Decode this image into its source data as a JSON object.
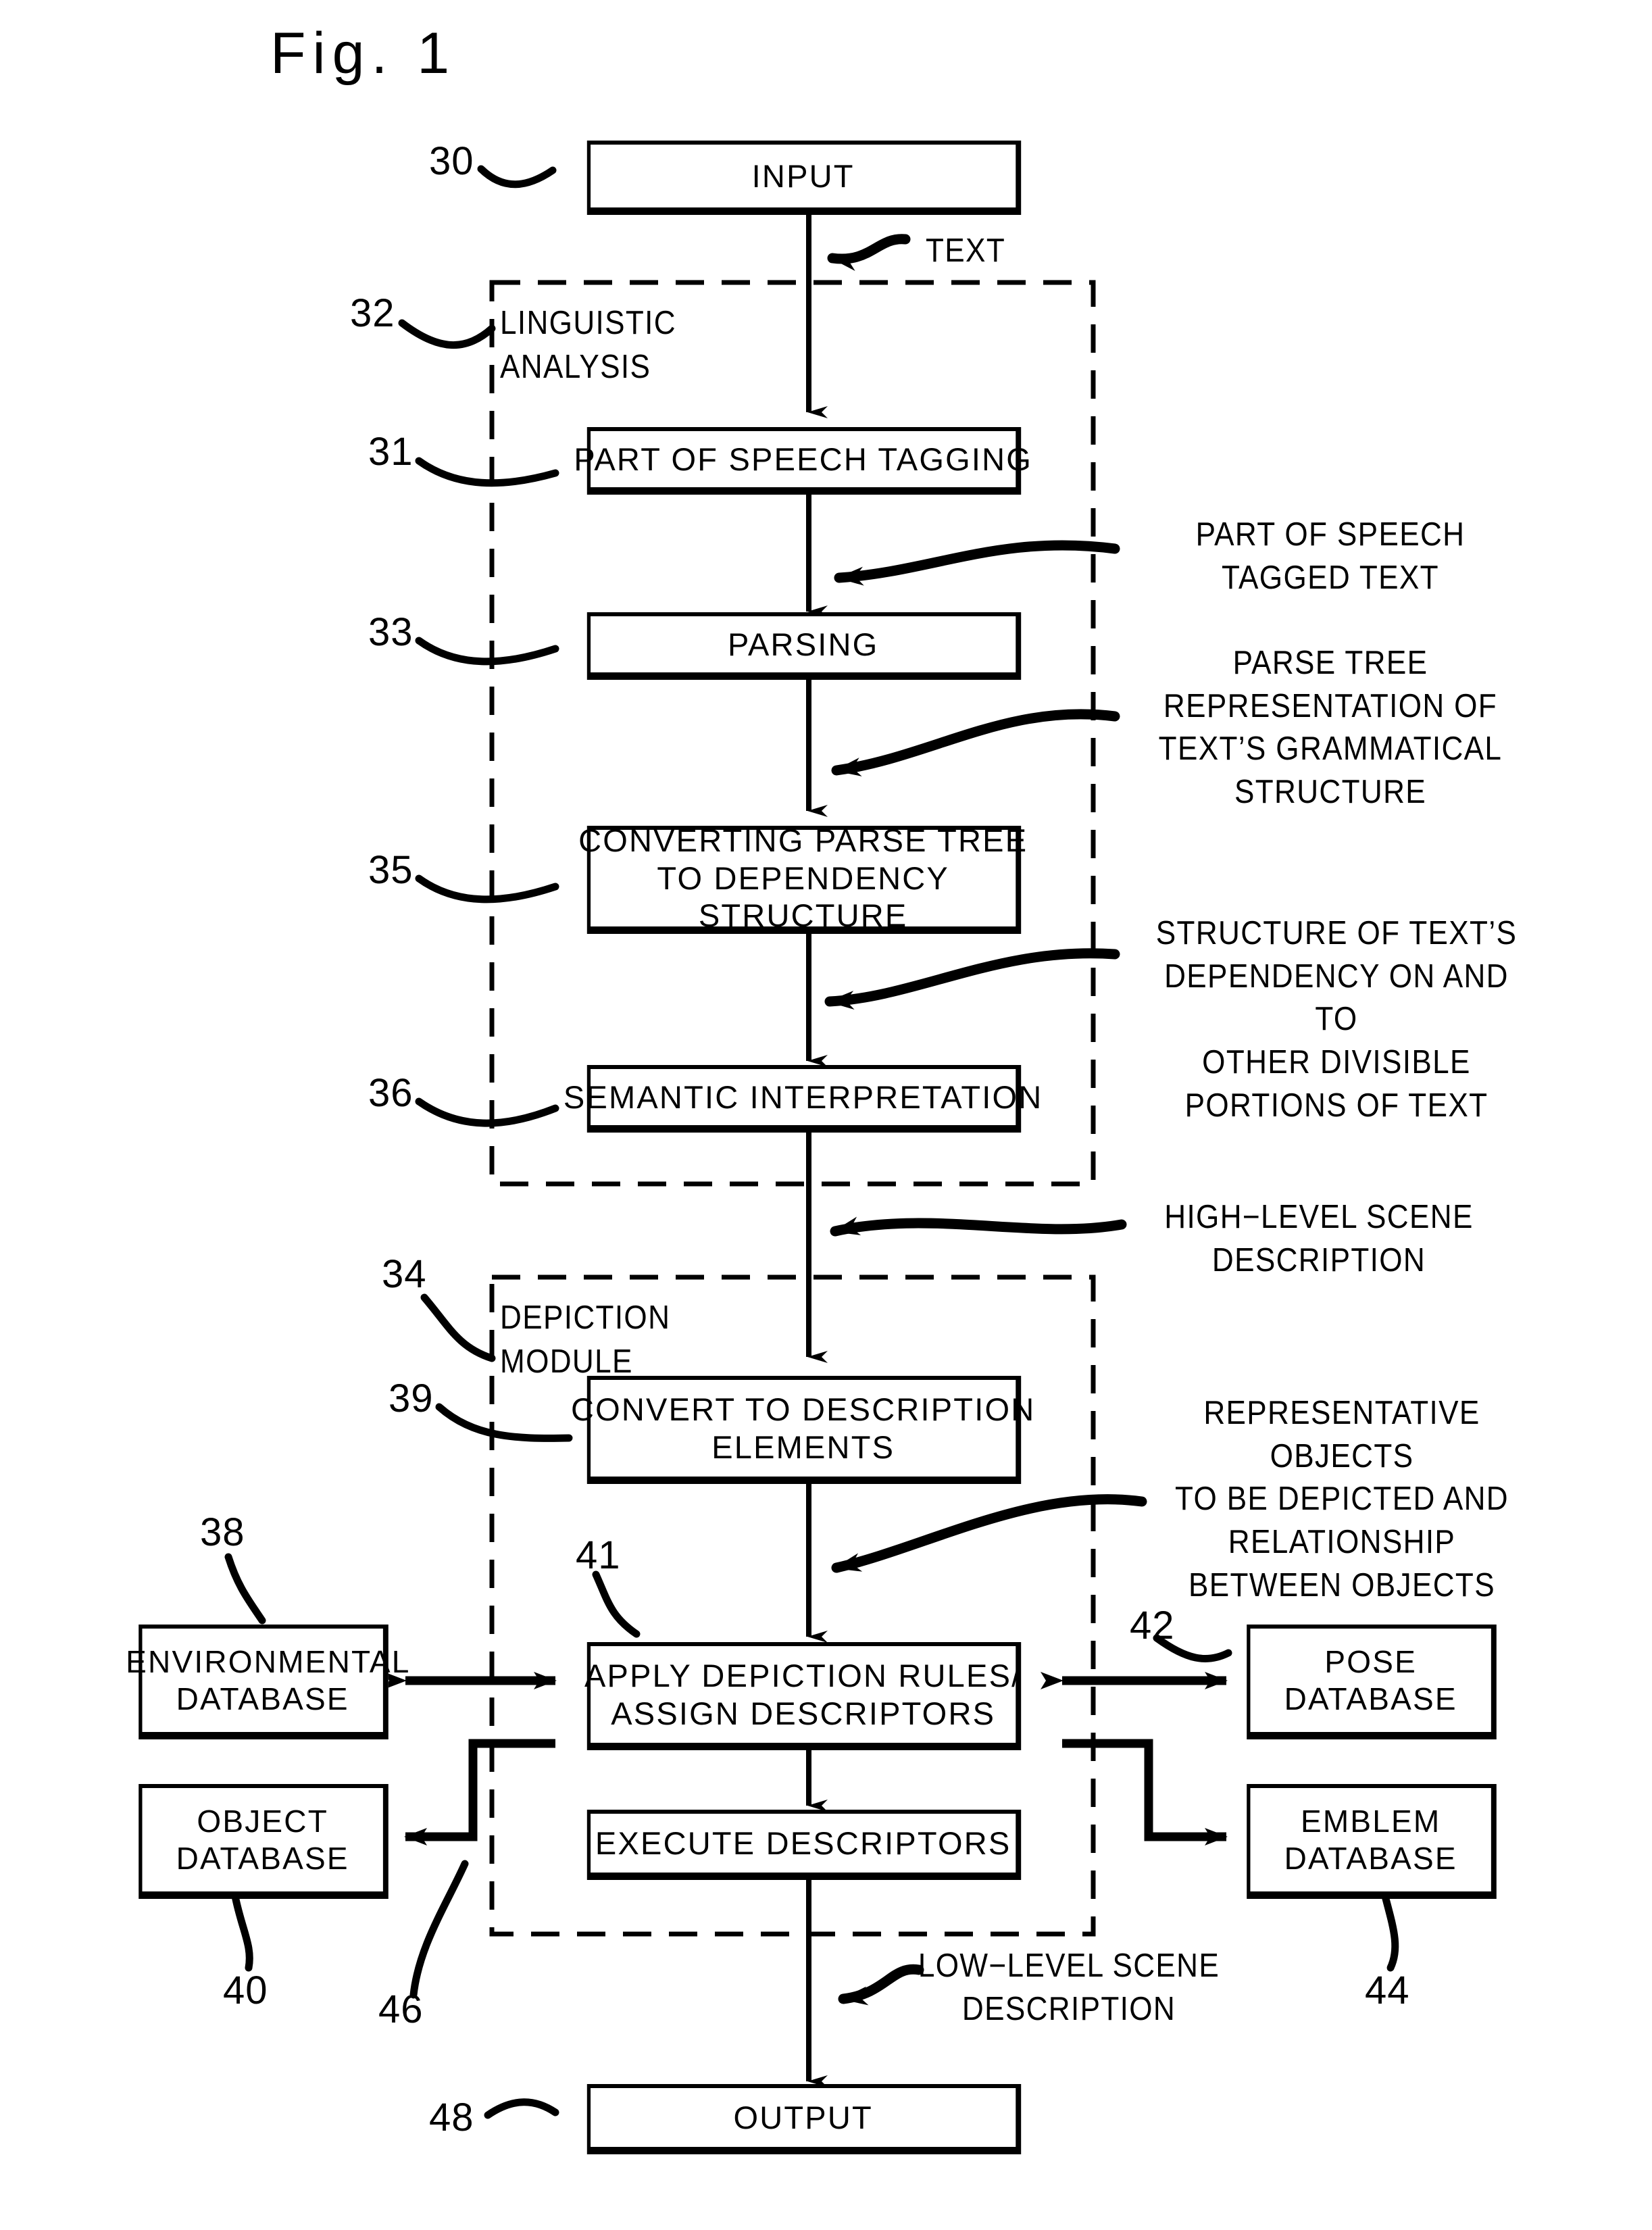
{
  "figure": {
    "title": "Fig. 1"
  },
  "boxes": {
    "input": {
      "label": "INPUT",
      "ref": "30"
    },
    "pos_tagging": {
      "label": "PART OF SPEECH TAGGING",
      "ref": "31"
    },
    "parsing": {
      "label": "PARSING",
      "ref": "33"
    },
    "converting": {
      "label": "CONVERTING PARSE TREE TO\nDEPENDENCY STRUCTURE",
      "ref": "35"
    },
    "semantic": {
      "label": "SEMANTIC INTERPRETATION",
      "ref": "36"
    },
    "convert_desc": {
      "label": "CONVERT TO DESCRIPTION\nELEMENTS",
      "ref": "39"
    },
    "apply_rules": {
      "label": "APPLY DEPICTION RULES/\nASSIGN DESCRIPTORS",
      "ref": "41"
    },
    "execute_desc": {
      "label": "EXECUTE DESCRIPTORS",
      "ref": "46"
    },
    "output": {
      "label": "OUTPUT",
      "ref": "48"
    },
    "env_db": {
      "label": "ENVIRONMENTAL\nDATABASE",
      "ref": "38"
    },
    "object_db": {
      "label": "OBJECT\nDATABASE",
      "ref": "40"
    },
    "pose_db": {
      "label": "POSE\nDATABASE",
      "ref": "42"
    },
    "emblem_db": {
      "label": "EMBLEM\nDATABASE",
      "ref": "44"
    }
  },
  "groups": {
    "linguistic": {
      "label": "LINGUISTIC\nANALYSIS",
      "ref": "32"
    },
    "depiction": {
      "label": "DEPICTION\nMODULE",
      "ref": "34"
    }
  },
  "annotations": {
    "text": "TEXT",
    "pos_tagged_text": "PART OF SPEECH\nTAGGED TEXT",
    "parse_tree": "PARSE TREE\nREPRESENTATION OF\nTEXT’S GRAMMATICAL\nSTRUCTURE",
    "dependency": "STRUCTURE OF TEXT’S\nDEPENDENCY ON AND TO\nOTHER DIVISIBLE\nPORTIONS OF TEXT",
    "high_level": "HIGH−LEVEL SCENE\nDESCRIPTION",
    "representative": "REPRESENTATIVE OBJECTS\nTO BE DEPICTED AND\nRELATIONSHIP\nBETWEEN OBJECTS",
    "low_level": "LOW−LEVEL SCENE\nDESCRIPTION"
  },
  "colors": {
    "ink": "#000000",
    "paper": "#ffffff"
  }
}
